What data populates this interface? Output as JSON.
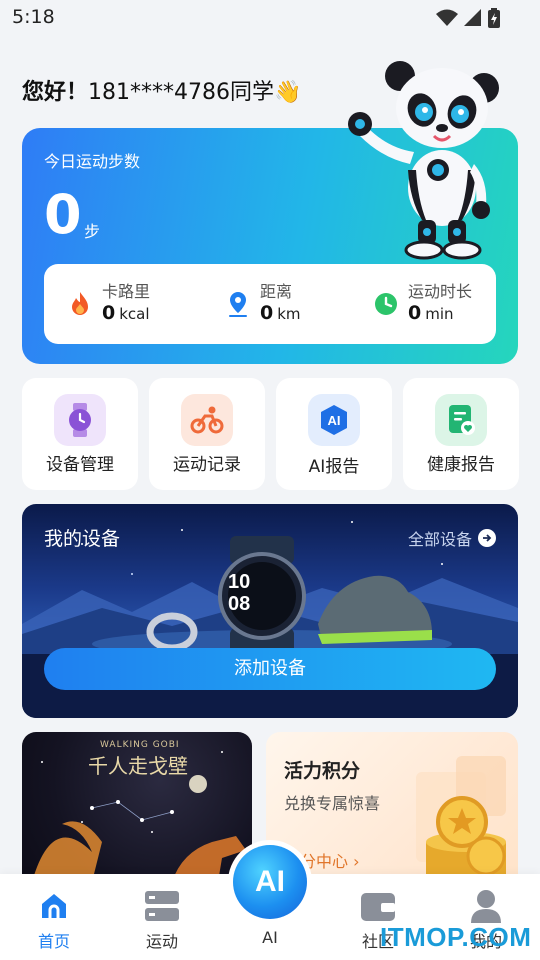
{
  "status_bar": {
    "time": "5:18"
  },
  "greeting": {
    "hello": "您好！",
    "user": "181****4786同学",
    "emoji": "👋"
  },
  "steps_card": {
    "label": "今日运动步数",
    "value": "0",
    "unit": "步",
    "metrics": [
      {
        "icon": "flame-icon",
        "label": "卡路里",
        "value": "0",
        "unit": "kcal"
      },
      {
        "icon": "location-pin-icon",
        "label": "距离",
        "value": "0",
        "unit": "km"
      },
      {
        "icon": "clock-icon",
        "label": "运动时长",
        "value": "0",
        "unit": "min"
      }
    ]
  },
  "quick_actions": [
    {
      "icon": "watch-icon",
      "label": "设备管理",
      "color": "#8a52d6"
    },
    {
      "icon": "cycling-icon",
      "label": "运动记录",
      "color": "#ef7a4a"
    },
    {
      "icon": "ai-badge-icon",
      "label": "AI报告",
      "icon_text": "AI",
      "color": "#1f6fe5"
    },
    {
      "icon": "health-report-icon",
      "label": "健康报告",
      "color": "#22b573"
    }
  ],
  "devices": {
    "title": "我的设备",
    "all_link": "全部设备",
    "add_button": "添加设备",
    "watch_time_hour": "10",
    "watch_time_min": "08"
  },
  "promo_left": {
    "title_en": "WALKING GOBI",
    "title_cn": "千人走戈壁"
  },
  "promo_right": {
    "title": "活力积分",
    "subtitle": "兑换专属惊喜",
    "link": "积分中心 ›"
  },
  "bottom_nav": {
    "items": [
      {
        "icon": "home-icon",
        "label": "首页",
        "active": true
      },
      {
        "icon": "sport-icon",
        "label": "运动",
        "active": false
      },
      {
        "icon": "ai-icon",
        "label": "AI",
        "active": false
      },
      {
        "icon": "wallet-icon",
        "label": "社区",
        "active": false
      },
      {
        "icon": "profile-icon",
        "label": "我的",
        "active": false
      }
    ],
    "ai_fab": "AI"
  },
  "watermark": "ITMOP.COM",
  "colors": {
    "accent": "#1f7ff0",
    "gradient_start": "#2f7cf6",
    "gradient_end": "#25d6bc"
  }
}
